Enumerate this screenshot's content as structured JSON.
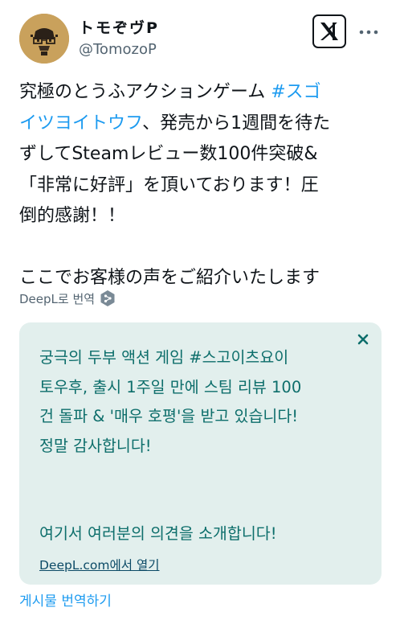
{
  "author": {
    "display_name": "トモぞヴP",
    "handle": "@TomozoP"
  },
  "tweet": {
    "lines": [
      "究極のとうふアクションゲーム ",
      "イツヨイトウフ、発売から1週間を待た",
      "ずしてSteamレビュー数100件突破&",
      "「非常に好評」を頂いております！圧",
      "倒的感謝！！",
      "ここでお客様の声をご紹介いたします"
    ],
    "hashtag_part1": "#スゴ",
    "hashtag_part2": "イツヨイトウフ",
    "line2_rest": "、発売から1週間を待た"
  },
  "deepl": {
    "label": "DeepL로 번역",
    "icon": "deepl-icon"
  },
  "translation": {
    "lines": [
      "궁극의 두부 액션 게임 #스고이츠요이",
      "토우후, 출시 1주일 만에 스팀 리뷰 100",
      "건 돌파 & '매우 호평'을 받고 있습니다!",
      "정말 감사합니다!",
      "여기서 여러분의 의견을 소개합니다!"
    ],
    "open_link": "DeepL.com에서 열기",
    "close_icon": "close-icon",
    "background": "#e2efed",
    "text_color": "#0d6e6b"
  },
  "translate_post": "게시물 번역하기",
  "colors": {
    "hashtag": "#1d9bf0",
    "secondary": "#536471",
    "avatar_bg": "#c9a15c"
  }
}
